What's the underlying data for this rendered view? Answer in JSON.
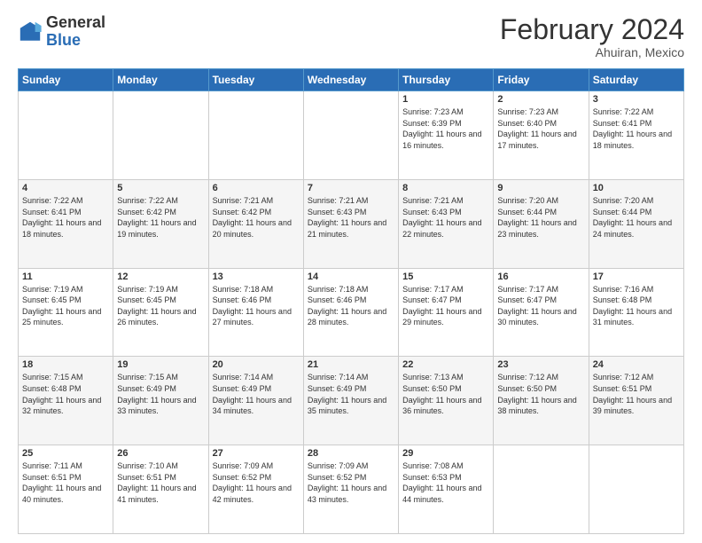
{
  "logo": {
    "general": "General",
    "blue": "Blue"
  },
  "header": {
    "title": "February 2024",
    "subtitle": "Ahuiran, Mexico"
  },
  "weekdays": [
    "Sunday",
    "Monday",
    "Tuesday",
    "Wednesday",
    "Thursday",
    "Friday",
    "Saturday"
  ],
  "weeks": [
    [
      {
        "day": "",
        "sunrise": "",
        "sunset": "",
        "daylight": ""
      },
      {
        "day": "",
        "sunrise": "",
        "sunset": "",
        "daylight": ""
      },
      {
        "day": "",
        "sunrise": "",
        "sunset": "",
        "daylight": ""
      },
      {
        "day": "",
        "sunrise": "",
        "sunset": "",
        "daylight": ""
      },
      {
        "day": "1",
        "sunrise": "7:23 AM",
        "sunset": "6:39 PM",
        "daylight": "11 hours and 16 minutes."
      },
      {
        "day": "2",
        "sunrise": "7:23 AM",
        "sunset": "6:40 PM",
        "daylight": "11 hours and 17 minutes."
      },
      {
        "day": "3",
        "sunrise": "7:22 AM",
        "sunset": "6:41 PM",
        "daylight": "11 hours and 18 minutes."
      }
    ],
    [
      {
        "day": "4",
        "sunrise": "7:22 AM",
        "sunset": "6:41 PM",
        "daylight": "11 hours and 18 minutes."
      },
      {
        "day": "5",
        "sunrise": "7:22 AM",
        "sunset": "6:42 PM",
        "daylight": "11 hours and 19 minutes."
      },
      {
        "day": "6",
        "sunrise": "7:21 AM",
        "sunset": "6:42 PM",
        "daylight": "11 hours and 20 minutes."
      },
      {
        "day": "7",
        "sunrise": "7:21 AM",
        "sunset": "6:43 PM",
        "daylight": "11 hours and 21 minutes."
      },
      {
        "day": "8",
        "sunrise": "7:21 AM",
        "sunset": "6:43 PM",
        "daylight": "11 hours and 22 minutes."
      },
      {
        "day": "9",
        "sunrise": "7:20 AM",
        "sunset": "6:44 PM",
        "daylight": "11 hours and 23 minutes."
      },
      {
        "day": "10",
        "sunrise": "7:20 AM",
        "sunset": "6:44 PM",
        "daylight": "11 hours and 24 minutes."
      }
    ],
    [
      {
        "day": "11",
        "sunrise": "7:19 AM",
        "sunset": "6:45 PM",
        "daylight": "11 hours and 25 minutes."
      },
      {
        "day": "12",
        "sunrise": "7:19 AM",
        "sunset": "6:45 PM",
        "daylight": "11 hours and 26 minutes."
      },
      {
        "day": "13",
        "sunrise": "7:18 AM",
        "sunset": "6:46 PM",
        "daylight": "11 hours and 27 minutes."
      },
      {
        "day": "14",
        "sunrise": "7:18 AM",
        "sunset": "6:46 PM",
        "daylight": "11 hours and 28 minutes."
      },
      {
        "day": "15",
        "sunrise": "7:17 AM",
        "sunset": "6:47 PM",
        "daylight": "11 hours and 29 minutes."
      },
      {
        "day": "16",
        "sunrise": "7:17 AM",
        "sunset": "6:47 PM",
        "daylight": "11 hours and 30 minutes."
      },
      {
        "day": "17",
        "sunrise": "7:16 AM",
        "sunset": "6:48 PM",
        "daylight": "11 hours and 31 minutes."
      }
    ],
    [
      {
        "day": "18",
        "sunrise": "7:15 AM",
        "sunset": "6:48 PM",
        "daylight": "11 hours and 32 minutes."
      },
      {
        "day": "19",
        "sunrise": "7:15 AM",
        "sunset": "6:49 PM",
        "daylight": "11 hours and 33 minutes."
      },
      {
        "day": "20",
        "sunrise": "7:14 AM",
        "sunset": "6:49 PM",
        "daylight": "11 hours and 34 minutes."
      },
      {
        "day": "21",
        "sunrise": "7:14 AM",
        "sunset": "6:49 PM",
        "daylight": "11 hours and 35 minutes."
      },
      {
        "day": "22",
        "sunrise": "7:13 AM",
        "sunset": "6:50 PM",
        "daylight": "11 hours and 36 minutes."
      },
      {
        "day": "23",
        "sunrise": "7:12 AM",
        "sunset": "6:50 PM",
        "daylight": "11 hours and 38 minutes."
      },
      {
        "day": "24",
        "sunrise": "7:12 AM",
        "sunset": "6:51 PM",
        "daylight": "11 hours and 39 minutes."
      }
    ],
    [
      {
        "day": "25",
        "sunrise": "7:11 AM",
        "sunset": "6:51 PM",
        "daylight": "11 hours and 40 minutes."
      },
      {
        "day": "26",
        "sunrise": "7:10 AM",
        "sunset": "6:51 PM",
        "daylight": "11 hours and 41 minutes."
      },
      {
        "day": "27",
        "sunrise": "7:09 AM",
        "sunset": "6:52 PM",
        "daylight": "11 hours and 42 minutes."
      },
      {
        "day": "28",
        "sunrise": "7:09 AM",
        "sunset": "6:52 PM",
        "daylight": "11 hours and 43 minutes."
      },
      {
        "day": "29",
        "sunrise": "7:08 AM",
        "sunset": "6:53 PM",
        "daylight": "11 hours and 44 minutes."
      },
      {
        "day": "",
        "sunrise": "",
        "sunset": "",
        "daylight": ""
      },
      {
        "day": "",
        "sunrise": "",
        "sunset": "",
        "daylight": ""
      }
    ]
  ]
}
